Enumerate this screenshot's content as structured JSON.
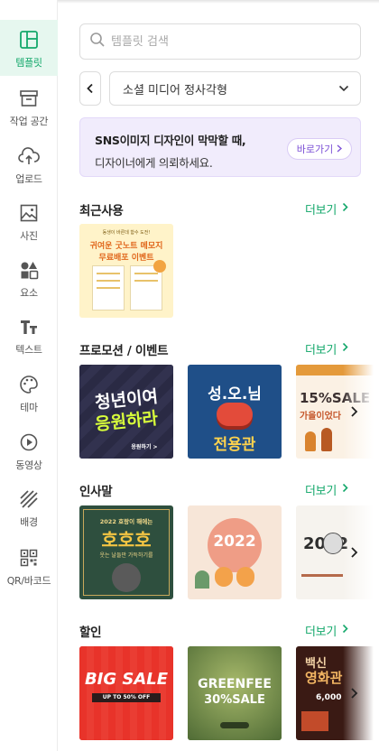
{
  "sidebar": {
    "items": [
      {
        "label": "템플릿",
        "icon": "template-icon",
        "active": true
      },
      {
        "label": "작업 공간",
        "icon": "archive-icon"
      },
      {
        "label": "업로드",
        "icon": "upload-cloud-icon"
      },
      {
        "label": "사진",
        "icon": "photo-icon"
      },
      {
        "label": "요소",
        "icon": "shapes-icon"
      },
      {
        "label": "텍스트",
        "icon": "text-icon"
      },
      {
        "label": "테마",
        "icon": "palette-icon"
      },
      {
        "label": "동영상",
        "icon": "play-icon"
      },
      {
        "label": "배경",
        "icon": "stripes-icon"
      },
      {
        "label": "QR/바코드",
        "icon": "qr-icon"
      }
    ]
  },
  "search": {
    "placeholder": "템플릿 검색"
  },
  "category": {
    "selected": "소셜 미디어 정사각형"
  },
  "banner": {
    "line1": "SNS이미지 디자인이 막막할 때,",
    "line2": "디자이너에게 의뢰하세요.",
    "button": "바로가기"
  },
  "sections": {
    "recent": {
      "title": "최근사용",
      "more": "더보기",
      "thumbs": [
        {
          "lines": [
            "동생이 바른데 함수 도전!",
            "귀여운 굿노트 메모지",
            "무료배포 이벤트"
          ]
        }
      ]
    },
    "promo": {
      "title": "프로모션 / 이벤트",
      "more": "더보기",
      "thumbs": [
        {
          "lines": [
            "청년이여",
            "응원하라",
            "응원하기 >"
          ]
        },
        {
          "lines": [
            "성.오.님",
            "전용관"
          ]
        },
        {
          "lines": [
            "15%SALE",
            "가을이었다"
          ]
        }
      ]
    },
    "greeting": {
      "title": "인사말",
      "more": "더보기",
      "thumbs": [
        {
          "lines": [
            "2022 호랑이 해에는",
            "호호호",
            "웃는 날들만 가득하기를"
          ]
        },
        {
          "lines": [
            "2022"
          ]
        },
        {
          "lines": [
            "2022"
          ]
        }
      ]
    },
    "discount": {
      "title": "할인",
      "more": "더보기",
      "thumbs": [
        {
          "lines": [
            "BIG SALE",
            "UP TO 50% OFF"
          ]
        },
        {
          "lines": [
            "GREENFEE",
            "30%SALE"
          ]
        },
        {
          "lines": [
            "백신",
            "영화관",
            "6,000"
          ]
        }
      ]
    }
  },
  "colors": {
    "accent": "#14a86b",
    "banner_bg": "#f1ecfc",
    "banner_link": "#7b4fd6"
  }
}
